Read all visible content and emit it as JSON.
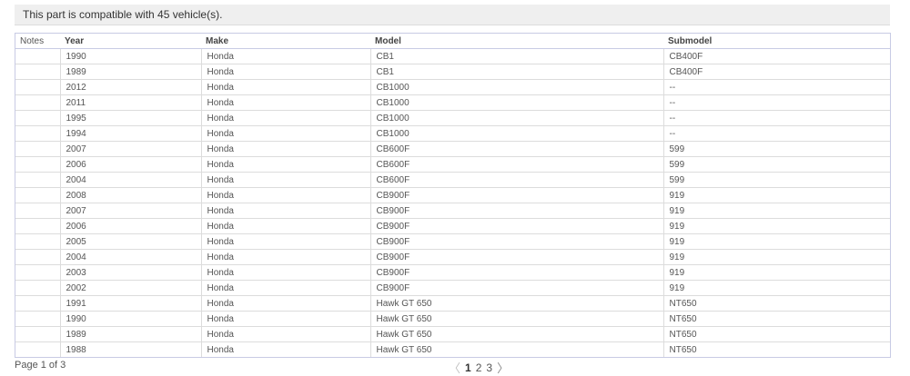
{
  "compat": {
    "message": "This part is compatible with 45 vehicle(s)."
  },
  "table": {
    "headers": {
      "notes": "Notes",
      "year": "Year",
      "make": "Make",
      "model": "Model",
      "submodel": "Submodel"
    },
    "rows": [
      {
        "notes": "",
        "year": "1990",
        "make": "Honda",
        "model": "CB1",
        "submodel": "CB400F"
      },
      {
        "notes": "",
        "year": "1989",
        "make": "Honda",
        "model": "CB1",
        "submodel": "CB400F"
      },
      {
        "notes": "",
        "year": "2012",
        "make": "Honda",
        "model": "CB1000",
        "submodel": "--"
      },
      {
        "notes": "",
        "year": "2011",
        "make": "Honda",
        "model": "CB1000",
        "submodel": "--"
      },
      {
        "notes": "",
        "year": "1995",
        "make": "Honda",
        "model": "CB1000",
        "submodel": "--"
      },
      {
        "notes": "",
        "year": "1994",
        "make": "Honda",
        "model": "CB1000",
        "submodel": "--"
      },
      {
        "notes": "",
        "year": "2007",
        "make": "Honda",
        "model": "CB600F",
        "submodel": "599"
      },
      {
        "notes": "",
        "year": "2006",
        "make": "Honda",
        "model": "CB600F",
        "submodel": "599"
      },
      {
        "notes": "",
        "year": "2004",
        "make": "Honda",
        "model": "CB600F",
        "submodel": "599"
      },
      {
        "notes": "",
        "year": "2008",
        "make": "Honda",
        "model": "CB900F",
        "submodel": "919"
      },
      {
        "notes": "",
        "year": "2007",
        "make": "Honda",
        "model": "CB900F",
        "submodel": "919"
      },
      {
        "notes": "",
        "year": "2006",
        "make": "Honda",
        "model": "CB900F",
        "submodel": "919"
      },
      {
        "notes": "",
        "year": "2005",
        "make": "Honda",
        "model": "CB900F",
        "submodel": "919"
      },
      {
        "notes": "",
        "year": "2004",
        "make": "Honda",
        "model": "CB900F",
        "submodel": "919"
      },
      {
        "notes": "",
        "year": "2003",
        "make": "Honda",
        "model": "CB900F",
        "submodel": "919"
      },
      {
        "notes": "",
        "year": "2002",
        "make": "Honda",
        "model": "CB900F",
        "submodel": "919"
      },
      {
        "notes": "",
        "year": "1991",
        "make": "Honda",
        "model": "Hawk GT 650",
        "submodel": "NT650"
      },
      {
        "notes": "",
        "year": "1990",
        "make": "Honda",
        "model": "Hawk GT 650",
        "submodel": "NT650"
      },
      {
        "notes": "",
        "year": "1989",
        "make": "Honda",
        "model": "Hawk GT 650",
        "submodel": "NT650"
      },
      {
        "notes": "",
        "year": "1988",
        "make": "Honda",
        "model": "Hawk GT 650",
        "submodel": "NT650"
      }
    ]
  },
  "pagination": {
    "info": "Page 1 of 3",
    "prev_icon": "chevron-left-icon",
    "next_icon": "chevron-right-icon",
    "prev_glyph": "〈",
    "next_glyph": "〉",
    "pages": [
      "1",
      "2",
      "3"
    ],
    "current": "1"
  }
}
